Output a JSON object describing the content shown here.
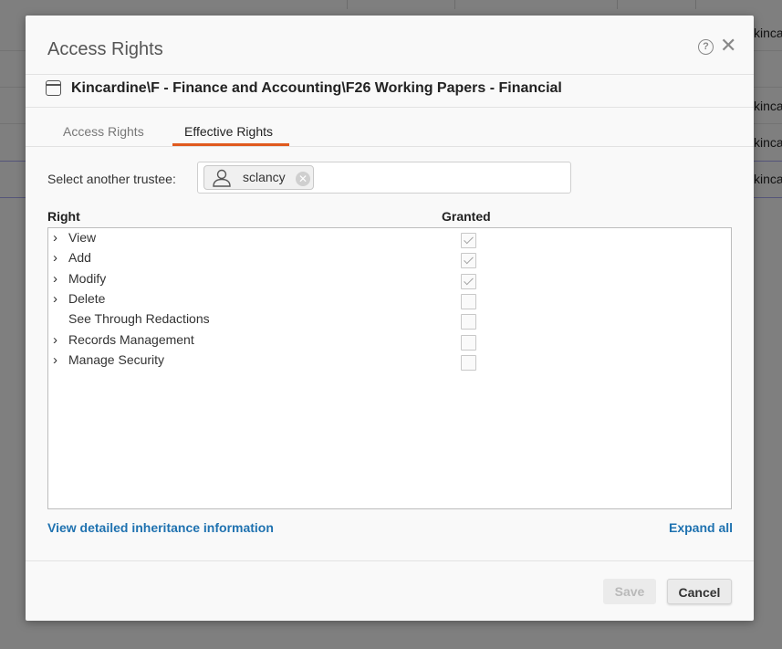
{
  "background": {
    "rows": [
      "kincardi",
      "kinca",
      "kinca",
      "kinca"
    ]
  },
  "dialog": {
    "title": "Access Rights",
    "help_glyph": "?",
    "close_glyph": "✕",
    "path": "Kincardine\\F - Finance and Accounting\\F26 Working Papers - Financial",
    "tabs": [
      {
        "label": "Access Rights",
        "active": false
      },
      {
        "label": "Effective Rights",
        "active": true
      }
    ],
    "trustee": {
      "label": "Select another trustee:",
      "value": "sclancy"
    },
    "columns": {
      "right": "Right",
      "granted": "Granted"
    },
    "rights": [
      {
        "label": "View",
        "expandable": true,
        "granted": true
      },
      {
        "label": "Add",
        "expandable": true,
        "granted": true
      },
      {
        "label": "Modify",
        "expandable": true,
        "granted": true
      },
      {
        "label": "Delete",
        "expandable": true,
        "granted": false
      },
      {
        "label": "See Through Redactions",
        "expandable": false,
        "granted": false
      },
      {
        "label": "Records Management",
        "expandable": true,
        "granted": false
      },
      {
        "label": "Manage Security",
        "expandable": true,
        "granted": false
      }
    ],
    "links": {
      "inheritance": "View detailed inheritance information",
      "expand_all": "Expand all"
    },
    "buttons": {
      "save": "Save",
      "cancel": "Cancel"
    },
    "colors": {
      "accent_tab": "#e05a1e",
      "link": "#1f72b0"
    }
  }
}
